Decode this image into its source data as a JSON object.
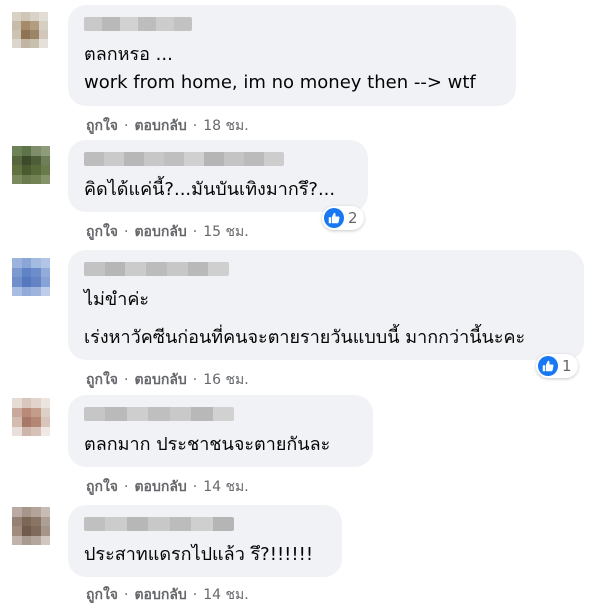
{
  "action_labels": {
    "like": "ถูกใจ",
    "reply": "ตอบกลับ",
    "separator": "·"
  },
  "colors": {
    "bubble": "#f0f2f5",
    "meta": "#65676b",
    "like_blue": "#1877f2"
  },
  "comments": [
    {
      "lines": [
        "ตลกหรอ ...",
        "work from home, im no money then --> wtf"
      ],
      "time": "18 ชม."
    },
    {
      "lines": [
        "คิดได้แค่นี้?...มันบันเทิงมากรึ?..."
      ],
      "time": "15 ชม.",
      "reaction": {
        "icon": "like-icon",
        "count": "2"
      }
    },
    {
      "lines": [
        "ไม่ขำค่ะ",
        "เร่งหาวัคซีนก่อนที่คนจะตายรายวันแบบนี้ มากกว่านี้นะคะ"
      ],
      "time": "16 ชม.",
      "reaction": {
        "icon": "like-icon",
        "count": "1"
      }
    },
    {
      "lines": [
        "ตลกมาก ประชาชนจะตายกันละ"
      ],
      "time": "14 ชม."
    },
    {
      "lines": [
        "ประสาทแดรกไปแล้ว รึ?!!!!!!"
      ],
      "time": "14 ชม."
    }
  ]
}
